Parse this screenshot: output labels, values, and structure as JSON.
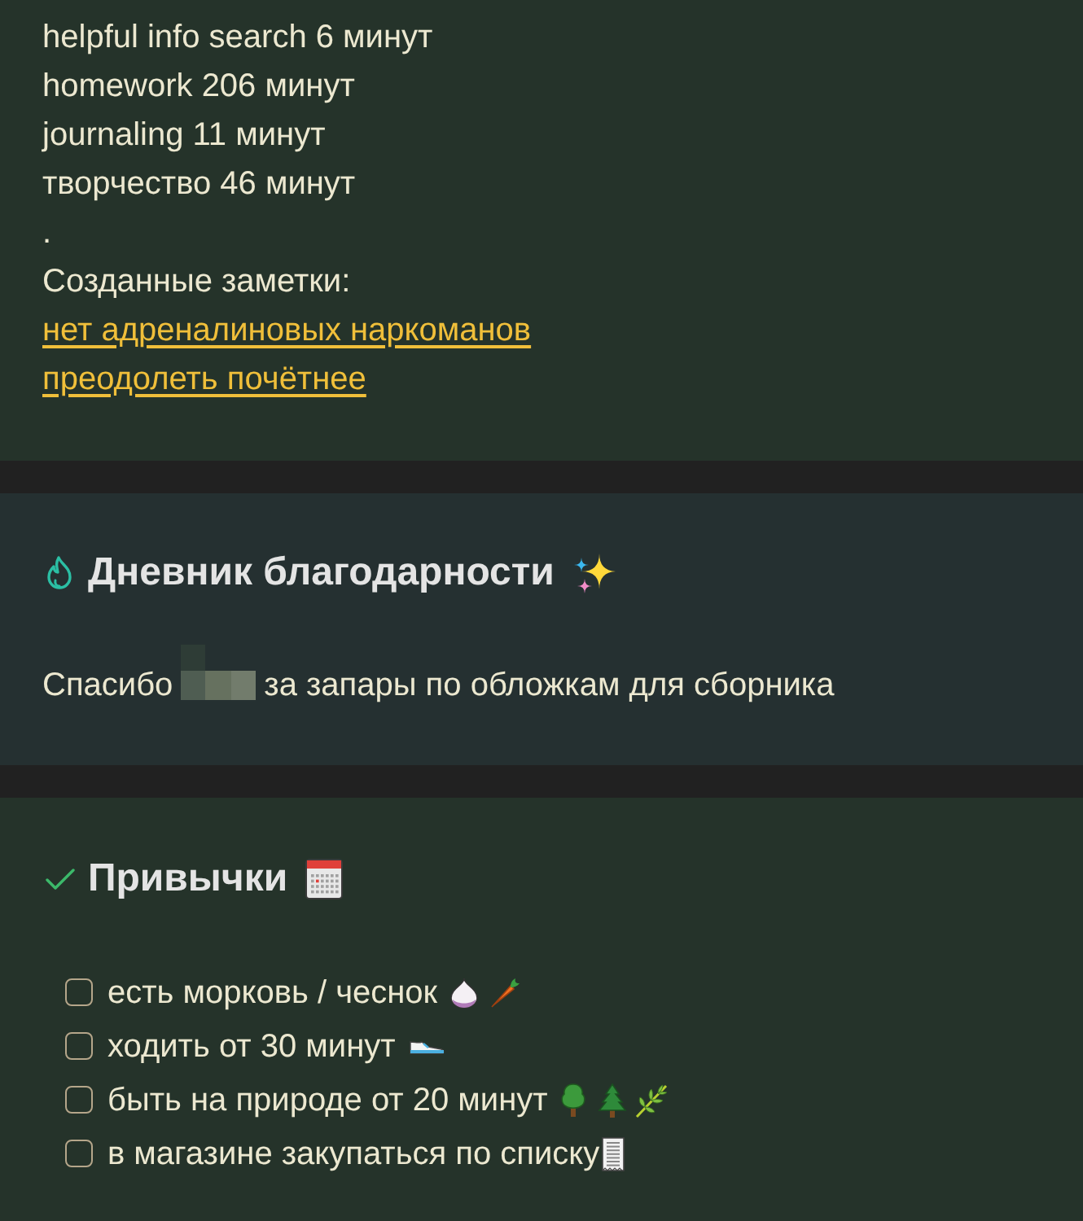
{
  "log_section": {
    "lines": [
      "helpful info search 6 минут",
      "homework 206 минут",
      "journaling 11 минут",
      "творчество 46 минут",
      "."
    ],
    "notes_label": "Созданные заметки:",
    "note_links": [
      "нет адреналиновых наркоманов",
      "преодолеть почётнее"
    ]
  },
  "gratitude_section": {
    "title": "Дневник благодарности",
    "entry": {
      "before": "Спасибо",
      "redacted": true,
      "after": "за запары по обложкам для сборника"
    }
  },
  "habits_section": {
    "title": "Привычки",
    "items": [
      {
        "label": "есть морковь / чеснок",
        "checked": false
      },
      {
        "label": "ходить от 30 минут",
        "checked": false
      },
      {
        "label": "быть на природе от 20 минут",
        "checked": false
      },
      {
        "label": "в магазине закупаться по списку",
        "checked": false
      }
    ]
  }
}
